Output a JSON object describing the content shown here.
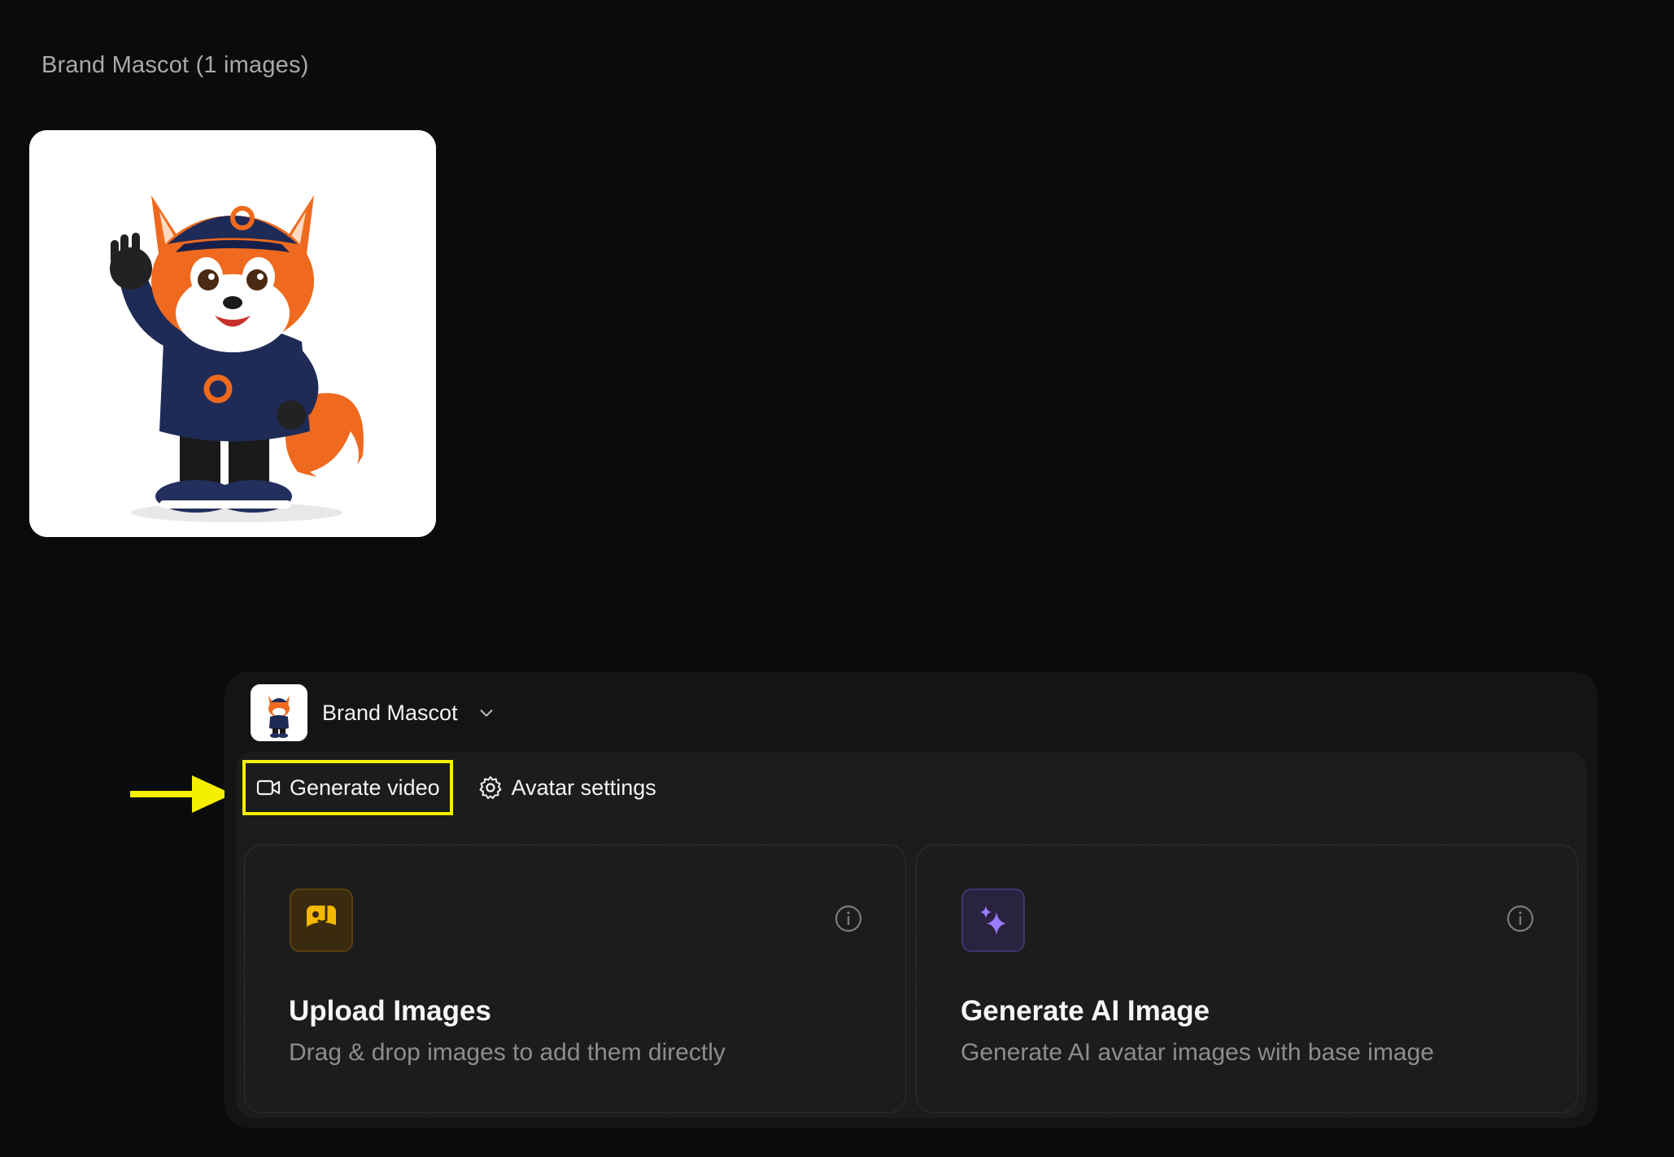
{
  "gallery": {
    "title": "Brand Mascot (1 images)"
  },
  "avatar_selector": {
    "name": "Brand Mascot",
    "dropdown_icon": "chevron-down-icon"
  },
  "tabs": [
    {
      "label": "Generate video",
      "icon": "video-camera-icon",
      "highlighted": true
    },
    {
      "label": "Avatar settings",
      "icon": "gear-icon",
      "highlighted": false
    }
  ],
  "cards": [
    {
      "title": "Upload Images",
      "description": "Drag & drop images to add them directly",
      "icon": "image-upload-icon",
      "accent": "#f5b800"
    },
    {
      "title": "Generate AI Image",
      "description": "Generate AI avatar images with base image",
      "icon": "sparkle-icon",
      "accent": "#9b7bff"
    }
  ],
  "colors": {
    "background": "#0b0b0b",
    "panel": "#141414",
    "highlight": "#f5ef00"
  }
}
